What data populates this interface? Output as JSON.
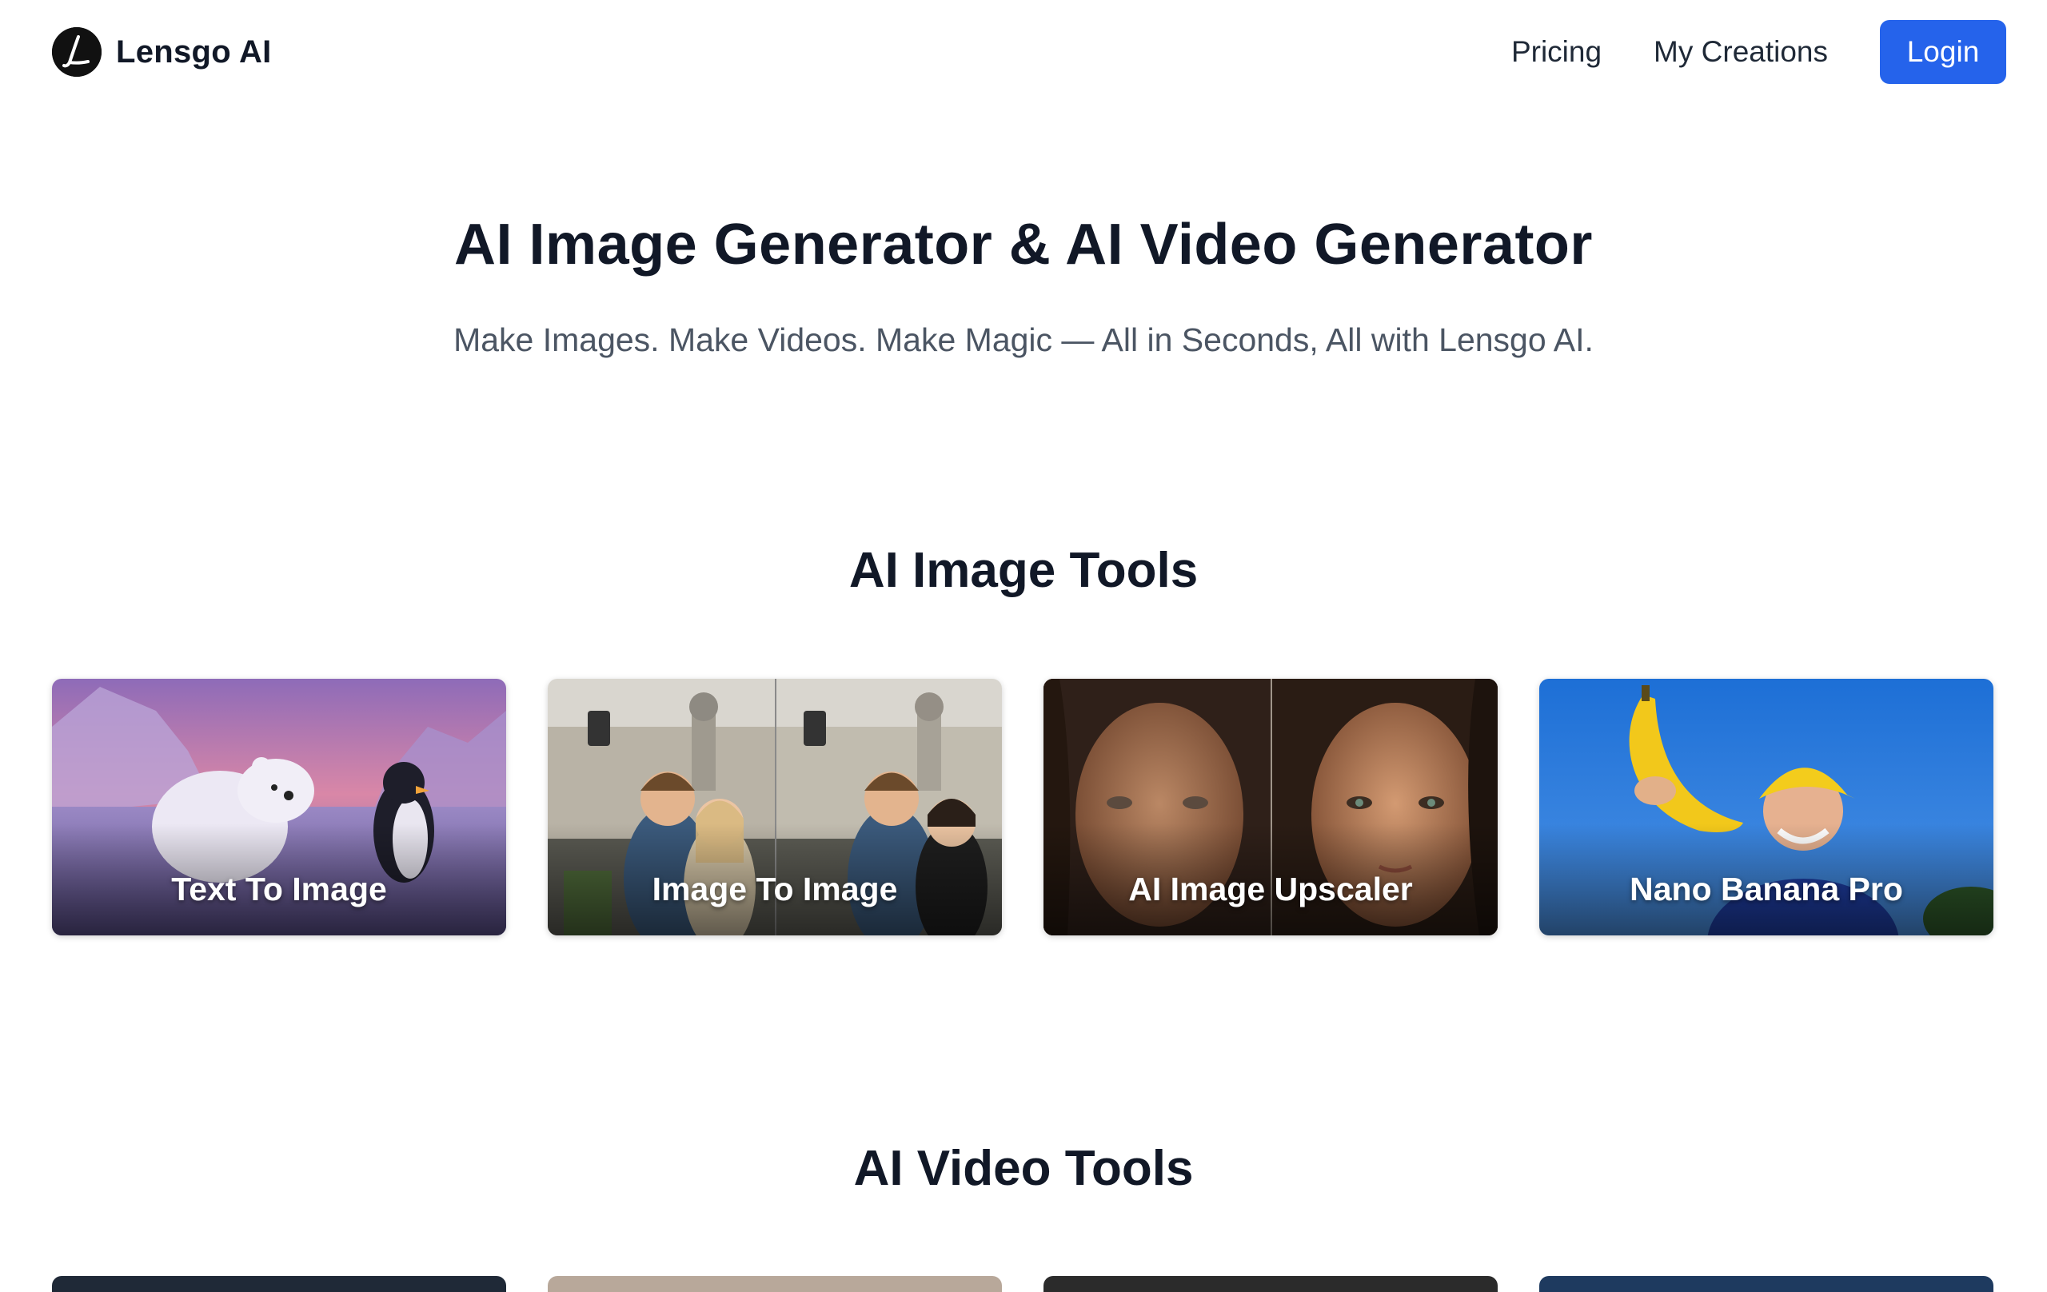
{
  "header": {
    "brand_name": "Lensgo AI",
    "nav": {
      "pricing": "Pricing",
      "my_creations": "My Creations",
      "login": "Login"
    }
  },
  "hero": {
    "title": "AI Image Generator & AI Video Generator",
    "subtitle": "Make Images. Make Videos. Make Magic — All in Seconds, All with Lensgo AI."
  },
  "image_tools": {
    "title": "AI Image Tools",
    "cards": [
      {
        "label": "Text To Image"
      },
      {
        "label": "Image To Image"
      },
      {
        "label": "AI Image Upscaler"
      },
      {
        "label": "Nano Banana Pro"
      }
    ]
  },
  "video_tools": {
    "title": "AI Video Tools"
  },
  "colors": {
    "accent": "#2563eb",
    "text": "#111827",
    "muted": "#4b5563"
  }
}
